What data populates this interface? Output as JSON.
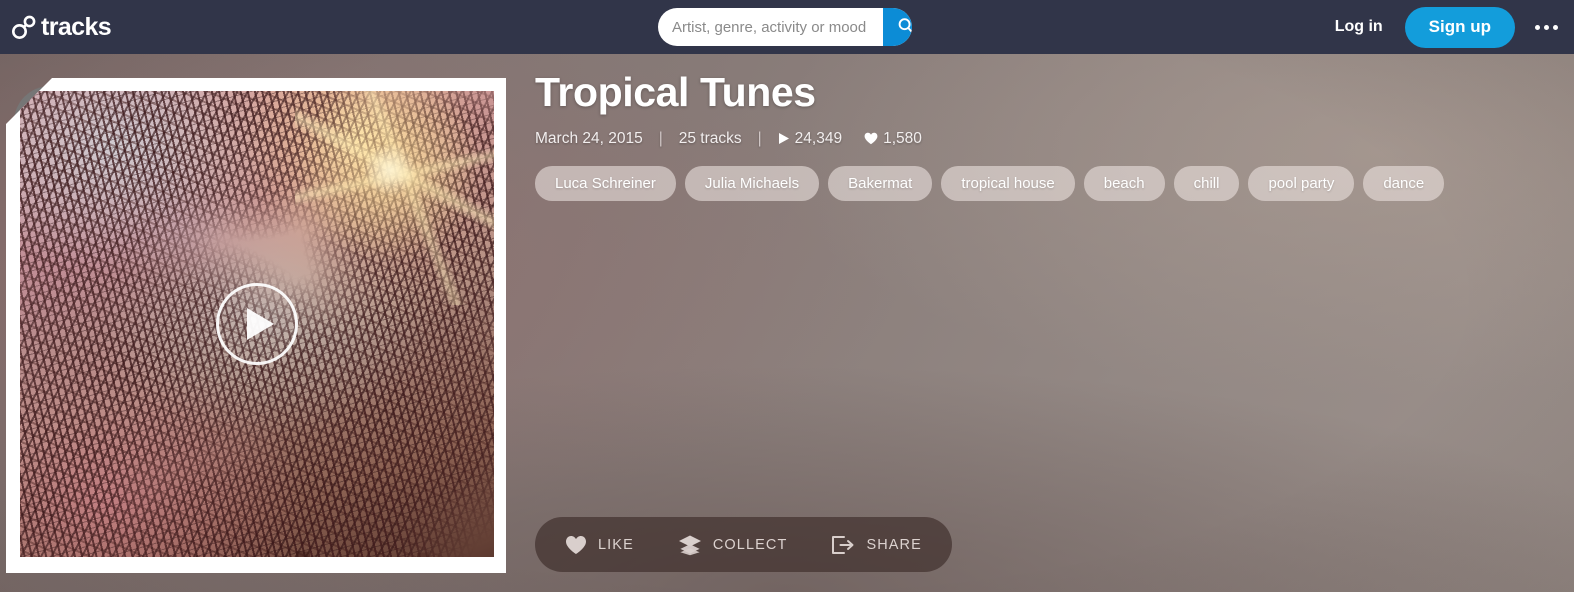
{
  "header": {
    "logo_text": "tracks",
    "search": {
      "placeholder": "Artist, genre, activity or mood",
      "value": "",
      "button_label": "search-icon"
    },
    "login_label": "Log in",
    "signup_label": "Sign up",
    "more_label": "More"
  },
  "playlist": {
    "title": "Tropical Tunes",
    "date": "March 24, 2015",
    "separator": "|",
    "track_count": "25 tracks",
    "plays": "24,349",
    "likes": "1,580",
    "tags": [
      "Luca Schreiner",
      "Julia Michaels",
      "Bakermat",
      "tropical house",
      "beach",
      "chill",
      "pool party",
      "dance"
    ]
  },
  "actions": {
    "like": "LIKE",
    "collect": "COLLECT",
    "share": "SHARE"
  },
  "colors": {
    "header_bg": "#313549",
    "accent_blue": "#139ddb",
    "search_button": "#0c8cd6",
    "page_bg_start": "#7d6e6c",
    "page_bg_end": "#9c918c",
    "actionbar_bg": "rgba(60,44,41,0.66)",
    "tag_bg": "rgba(232,222,219,0.62)"
  }
}
